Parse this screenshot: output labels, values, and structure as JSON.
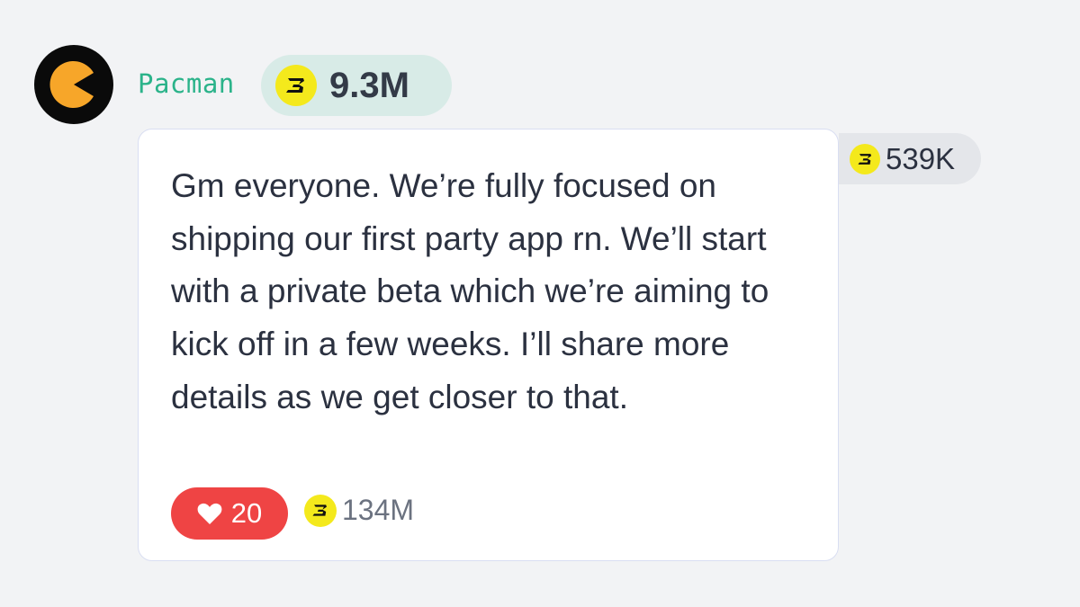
{
  "post": {
    "author": {
      "username": "Pacman",
      "avatar_icon": "pacman-icon",
      "badge_value": "9.3M"
    },
    "message": "Gm everyone. We’re fully focused on shipping our first party app rn. We’ll start with a private beta which we’re aiming to kick off in a few weeks. I’ll share more details as we get closer to that.",
    "likes": "20",
    "total_tips": "134M",
    "side_tip": "539K"
  },
  "colors": {
    "background": "#f2f3f5",
    "username": "#2bb38a",
    "like": "#ef4444",
    "coin": "#f4e91c",
    "user_badge_bg": "#d8ebe7",
    "side_tip_bg": "#e4e6ea"
  },
  "icons": {
    "coin": "b-coin-icon",
    "like": "heart-icon"
  }
}
